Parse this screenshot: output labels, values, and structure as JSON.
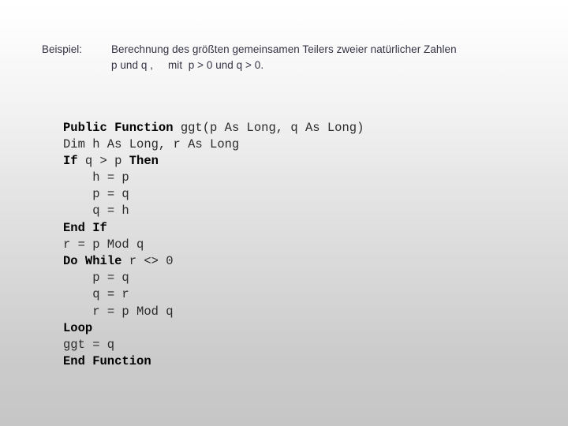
{
  "slide": {
    "background_top_color": "#ffffff",
    "background_bottom_color": "#c6c6c6",
    "text_color": "#333344",
    "code_color": "#1a1a1a"
  },
  "example": {
    "label": "Beispiel:",
    "lines": [
      "Berechnung des größten gemeinsamen Teilers zweier natürlicher Zahlen",
      "p und q ,     mit  p > 0 und q > 0."
    ]
  },
  "code": {
    "language": "Visual Basic",
    "lines": [
      {
        "indent": 0,
        "tokens": [
          {
            "t": "Public Function ",
            "bold": true
          },
          {
            "t": "ggt(p As Long, q As Long)",
            "bold": false
          }
        ]
      },
      {
        "indent": 0,
        "tokens": [
          {
            "t": "Dim h As Long, r As Long",
            "bold": false
          }
        ]
      },
      {
        "indent": 0,
        "tokens": [
          {
            "t": "If ",
            "bold": true
          },
          {
            "t": "q > p ",
            "bold": false
          },
          {
            "t": "Then",
            "bold": true
          }
        ]
      },
      {
        "indent": 4,
        "tokens": [
          {
            "t": "h = p",
            "bold": false
          }
        ]
      },
      {
        "indent": 4,
        "tokens": [
          {
            "t": "p = q",
            "bold": false
          }
        ]
      },
      {
        "indent": 4,
        "tokens": [
          {
            "t": "q = h",
            "bold": false
          }
        ]
      },
      {
        "indent": 0,
        "tokens": [
          {
            "t": "End If",
            "bold": true
          }
        ]
      },
      {
        "indent": 0,
        "tokens": [
          {
            "t": "r = p Mod q",
            "bold": false
          }
        ]
      },
      {
        "indent": 0,
        "tokens": [
          {
            "t": "Do While ",
            "bold": true
          },
          {
            "t": "r <> 0",
            "bold": false
          }
        ]
      },
      {
        "indent": 4,
        "tokens": [
          {
            "t": "p = q",
            "bold": false
          }
        ]
      },
      {
        "indent": 4,
        "tokens": [
          {
            "t": "q = r",
            "bold": false
          }
        ]
      },
      {
        "indent": 4,
        "tokens": [
          {
            "t": "r = p Mod q",
            "bold": false
          }
        ]
      },
      {
        "indent": 0,
        "tokens": [
          {
            "t": "Loop",
            "bold": true
          }
        ]
      },
      {
        "indent": 0,
        "tokens": [
          {
            "t": "ggt = q",
            "bold": false
          }
        ]
      },
      {
        "indent": 0,
        "tokens": [
          {
            "t": "End Function",
            "bold": true
          }
        ]
      }
    ]
  }
}
